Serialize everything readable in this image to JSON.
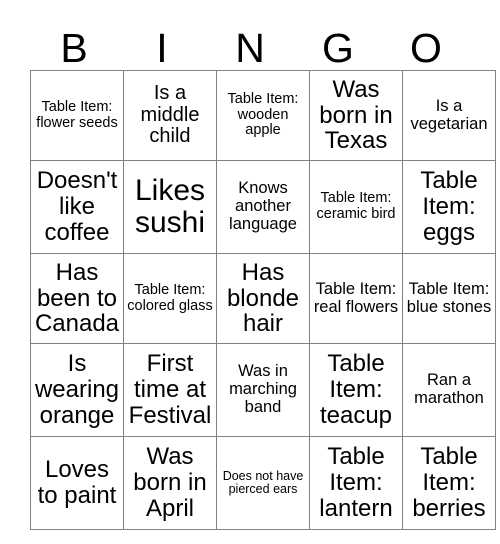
{
  "card": {
    "title": "BINGO",
    "header_letters": [
      "B",
      "I",
      "N",
      "G",
      "O"
    ],
    "rows": [
      [
        {
          "text": "Table Item: flower seeds",
          "size": "fs-s"
        },
        {
          "text": "Is a middle child",
          "size": "fs-l"
        },
        {
          "text": "Table Item: wooden apple",
          "size": "fs-s"
        },
        {
          "text": "Was born in Texas",
          "size": "fs-xl"
        },
        {
          "text": "Is a vegetarian",
          "size": "fs-m"
        }
      ],
      [
        {
          "text": "Doesn't like coffee",
          "size": "fs-xl"
        },
        {
          "text": "Likes sushi",
          "size": "fs-xxl"
        },
        {
          "text": "Knows another language",
          "size": "fs-m"
        },
        {
          "text": "Table Item: ceramic bird",
          "size": "fs-s"
        },
        {
          "text": "Table Item: eggs",
          "size": "fs-xl"
        }
      ],
      [
        {
          "text": "Has been to Canada",
          "size": "fs-xl"
        },
        {
          "text": "Table Item: colored glass",
          "size": "fs-s"
        },
        {
          "text": "Has blonde hair",
          "size": "fs-xl"
        },
        {
          "text": "Table Item: real flowers",
          "size": "fs-m"
        },
        {
          "text": "Table Item: blue stones",
          "size": "fs-m"
        }
      ],
      [
        {
          "text": "Is wearing orange",
          "size": "fs-xl"
        },
        {
          "text": "First time at Festival",
          "size": "fs-xl"
        },
        {
          "text": "Was in marching band",
          "size": "fs-m"
        },
        {
          "text": "Table Item: teacup",
          "size": "fs-xl"
        },
        {
          "text": "Ran a marathon",
          "size": "fs-m"
        }
      ],
      [
        {
          "text": "Loves to paint",
          "size": "fs-xl"
        },
        {
          "text": "Was born in April",
          "size": "fs-xl"
        },
        {
          "text": "Does not have pierced ears",
          "size": "fs-xs"
        },
        {
          "text": "Table Item: lantern",
          "size": "fs-xl"
        },
        {
          "text": "Table Item: berries",
          "size": "fs-xl"
        }
      ]
    ]
  },
  "colors": {
    "background": "#ffffff",
    "text": "#000000",
    "grid_line": "#808080"
  }
}
